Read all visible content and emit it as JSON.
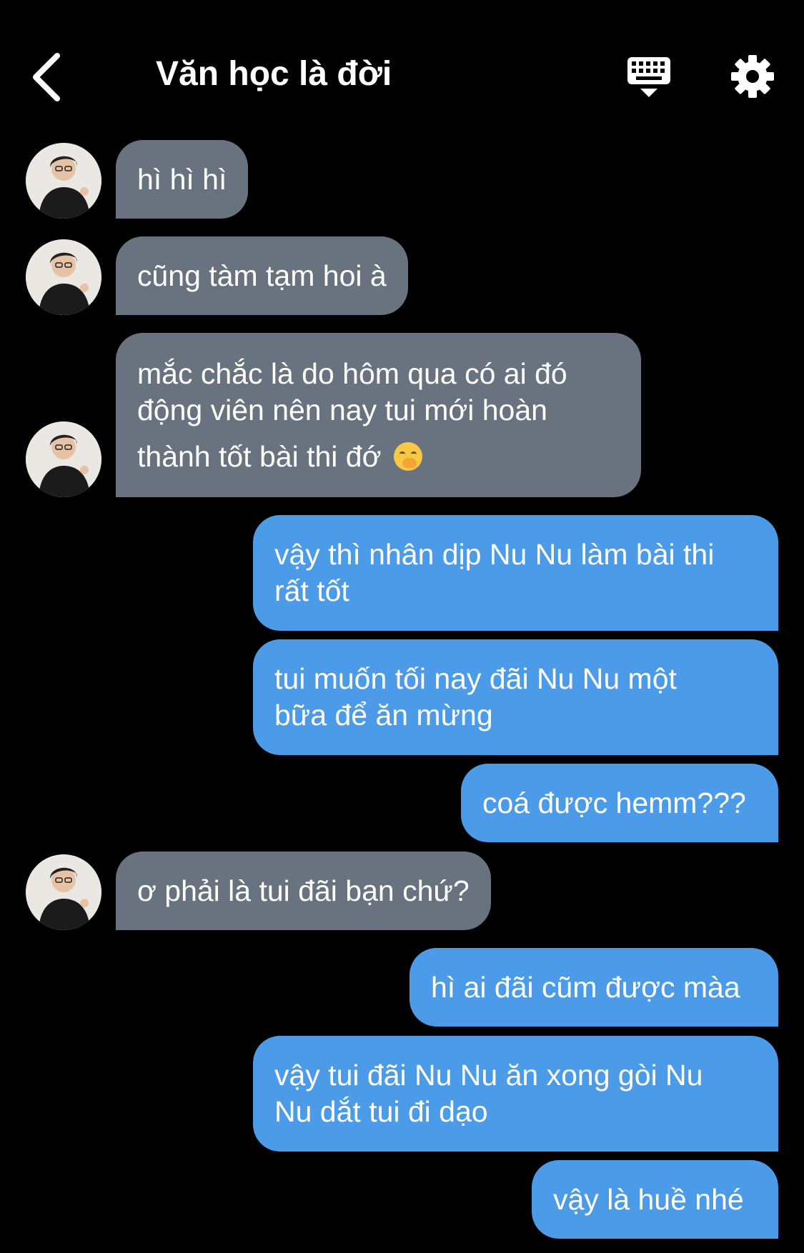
{
  "header": {
    "title": "Văn học là đời",
    "back_icon": "chevron-left-icon",
    "keyboard_icon": "keyboard-icon",
    "settings_icon": "gear-icon"
  },
  "colors": {
    "background": "#000000",
    "incoming_bubble": "#68737f",
    "outgoing_bubble": "#4b9be8",
    "text": "#ffffff"
  },
  "messages": [
    {
      "from": "other",
      "lines": [
        "hì hì hì"
      ]
    },
    {
      "from": "other",
      "lines": [
        "cũng tàm tạm hoi à"
      ]
    },
    {
      "from": "other",
      "lines": [
        "mắc chắc là do hôm qua có ai đó",
        "động viên nên nay tui mới hoàn",
        "thành tốt bài thi đớ"
      ],
      "emoji": "hand-over-mouth-emoji"
    },
    {
      "from": "me",
      "lines": [
        "vậy thì nhân dịp Nu Nu làm bài thi",
        "rất tốt"
      ]
    },
    {
      "from": "me",
      "lines": [
        "tui muốn tối nay đãi Nu Nu một",
        "bữa để ăn mừng"
      ]
    },
    {
      "from": "me",
      "lines": [
        "coá được hemm???"
      ]
    },
    {
      "from": "other",
      "lines": [
        "ơ phải là tui đãi bạn chứ?"
      ]
    },
    {
      "from": "me",
      "lines": [
        "hì ai đãi cũm được màa"
      ]
    },
    {
      "from": "me",
      "lines": [
        "vậy tui đãi Nu Nu ăn xong gòi Nu",
        "Nu dắt tui đi dạo"
      ]
    },
    {
      "from": "me",
      "lines": [
        "vậy là huề nhé"
      ]
    }
  ]
}
